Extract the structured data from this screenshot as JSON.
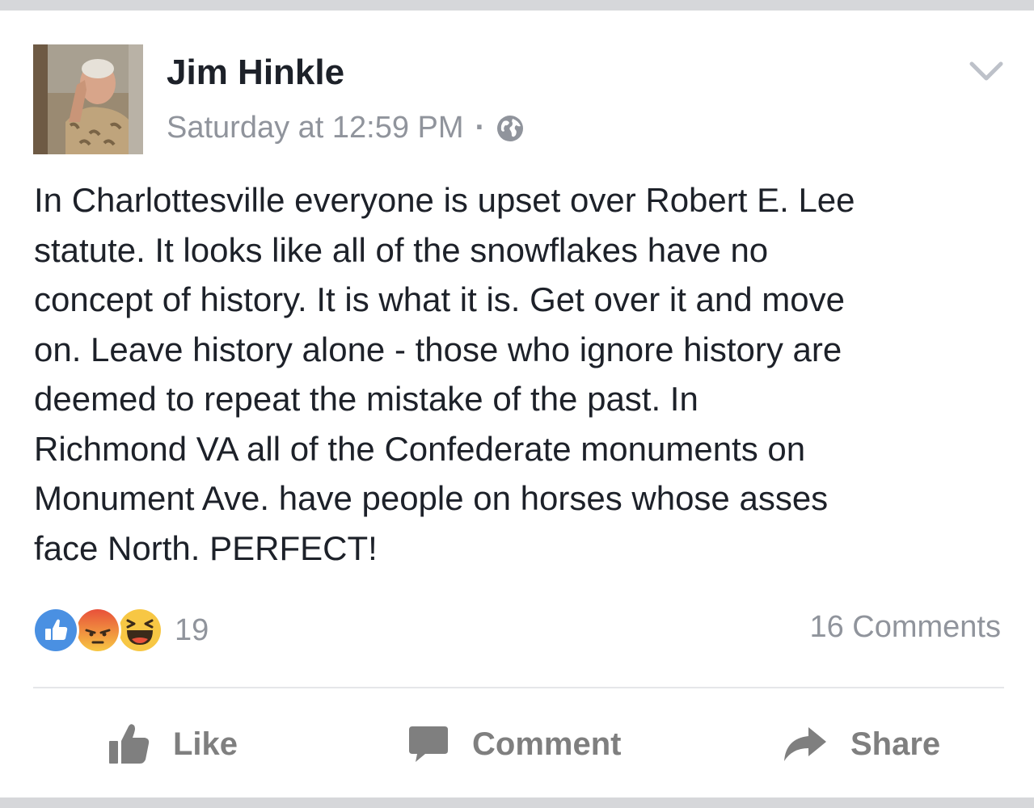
{
  "post": {
    "author": "Jim Hinkle",
    "timestamp": "Saturday at 12:59 PM",
    "separator": "·",
    "privacy_icon": "globe-icon",
    "menu_icon": "chevron-down-icon",
    "text": "In Charlottesville everyone is upset over Robert E. Lee\nstatute. It looks like all of the snowflakes have no\nconcept of history. It is what it is. Get over it and move\non. Leave history alone - those who ignore history are\ndeemed to repeat the mistake of the past. In\nRichmond VA all of the Confederate monuments on\nMonument Ave. have people on horses whose asses\nface North. PERFECT!"
  },
  "reactions": {
    "icons": [
      "like-reaction-icon",
      "angry-reaction-icon",
      "haha-reaction-icon"
    ],
    "count": "19",
    "colors": {
      "like": "#4a90e2",
      "angry": "#e8503a",
      "haha": "#f7c744"
    }
  },
  "comments": {
    "label": "16 Comments"
  },
  "actions": {
    "like": "Like",
    "comment": "Comment",
    "share": "Share"
  },
  "colors": {
    "text": "#1d2129",
    "secondary": "#90949c",
    "action": "#7f7f7f",
    "frame": "#d6d7da"
  }
}
